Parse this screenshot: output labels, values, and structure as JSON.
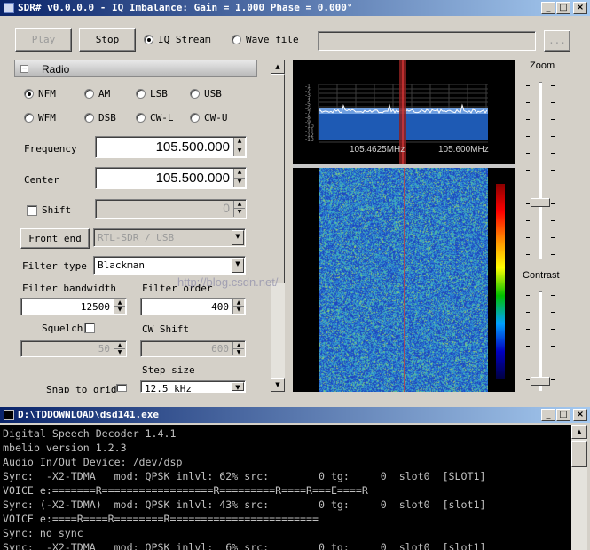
{
  "sdr": {
    "title": "SDR# v0.0.0.0 - IQ Imbalance: Gain = 1.000 Phase = 0.000°",
    "window_buttons": {
      "minimize": "_",
      "maximize": "□",
      "close": "×"
    },
    "toolbar": {
      "play_label": "Play",
      "stop_label": "Stop",
      "iq_stream_label": "IQ Stream",
      "wave_file_label": "Wave file",
      "wave_file_path": "",
      "browse_label": "...",
      "selected_source": "IQ Stream"
    },
    "radio": {
      "header": "Radio",
      "modes": [
        "NFM",
        "AM",
        "LSB",
        "USB",
        "WFM",
        "DSB",
        "CW-L",
        "CW-U"
      ],
      "selected_mode": "NFM",
      "frequency_label": "Frequency",
      "frequency_value": "105.500.000",
      "center_label": "Center",
      "center_value": "105.500.000",
      "shift_label": "Shift",
      "shift_value": "0",
      "front_end_label": "Front end",
      "front_end_value": "RTL-SDR / USB",
      "filter_type_label": "Filter type",
      "filter_type_value": "Blackman",
      "filter_bandwidth_label": "Filter bandwidth",
      "filter_bandwidth_value": "12500",
      "filter_order_label": "Filter order",
      "filter_order_value": "400",
      "squelch_label": "Squelch",
      "squelch_value": "50",
      "cw_shift_label": "CW Shift",
      "cw_shift_value": "600",
      "step_size_label": "Step size",
      "step_size_value": "12.5 kHz",
      "snap_to_grid_label": "Snap to grid"
    },
    "spectrum": {
      "freq_labels": [
        "105.4625MHz",
        "105.600MHz"
      ],
      "db_labels": [
        "-1",
        "-2",
        "-3",
        "-4",
        "-5",
        "-6",
        "-7",
        "-8",
        "-9",
        "-10",
        "-11",
        "-12",
        "-13"
      ]
    },
    "zoom_label": "Zoom",
    "contrast_label": "Contrast",
    "zoom_level": 0.32,
    "contrast_level": 0.33
  },
  "dsd": {
    "title": "D:\\TDDOWNLOAD\\dsd141.exe",
    "lines": [
      "Digital Speech Decoder 1.4.1",
      "mbelib version 1.2.3",
      "Audio In/Out Device: /dev/dsp",
      "Sync:  -X2-TDMA   mod: QPSK inlvl: 62% src:        0 tg:     0  slot0  [SLOT1]",
      "VOICE e:=======R==================R=========R====R===E====R",
      "Sync: (-X2-TDMA)  mod: QPSK inlvl: 43% src:        0 tg:     0  slot0  [slot1]",
      "VOICE e:====R====R========R========================",
      "Sync: no sync",
      "Sync:  -X2-TDMA   mod: QPSK inlvl:  6% src:        0 tg:     0  slot0  [slot1]"
    ]
  },
  "watermark": "http://blog.csdn.net/"
}
